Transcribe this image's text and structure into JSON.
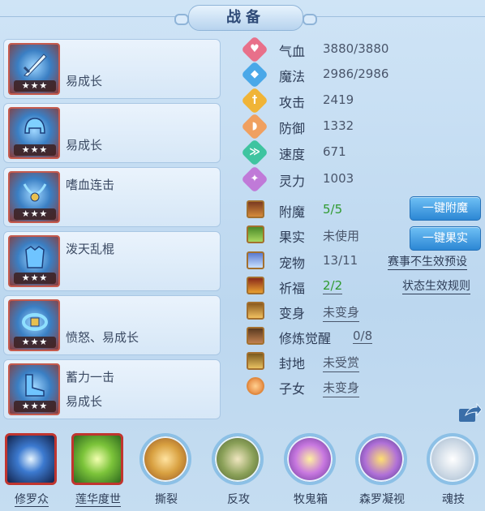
{
  "title": "战备",
  "equipment": [
    {
      "line1": "",
      "line2": "易成长",
      "stars": "★★★"
    },
    {
      "line1": "",
      "line2": "易成长",
      "stars": "★★★"
    },
    {
      "line1": "嗜血连击",
      "line2": "",
      "stars": "★★★"
    },
    {
      "line1": "泼天乱棍",
      "line2": "",
      "stars": "★★★"
    },
    {
      "line1": "",
      "line2": "愤怒、易成长",
      "stars": "★★★"
    },
    {
      "line1": "蓄力一击",
      "line2": "易成长",
      "stars": "★★★"
    }
  ],
  "stats": [
    {
      "name": "气血",
      "value": "3880/3880",
      "color": "#e8708a",
      "icon": "heart-icon",
      "glyph": "♥"
    },
    {
      "name": "魔法",
      "value": "2986/2986",
      "color": "#4aa8e8",
      "icon": "mana-icon",
      "glyph": "◆"
    },
    {
      "name": "攻击",
      "value": "2419",
      "color": "#f0b437",
      "icon": "sword-icon",
      "glyph": "†"
    },
    {
      "name": "防御",
      "value": "1332",
      "color": "#f0a060",
      "icon": "shield-icon",
      "glyph": "◗"
    },
    {
      "name": "速度",
      "value": "671",
      "color": "#3fc4a0",
      "icon": "speed-icon",
      "glyph": "≫"
    },
    {
      "name": "灵力",
      "value": "1003",
      "color": "#c07ad8",
      "icon": "spirit-icon",
      "glyph": "✦"
    }
  ],
  "features": [
    {
      "name": "附魔",
      "value": "5/5",
      "style": "green",
      "icon": "enchant-icon"
    },
    {
      "name": "果实",
      "value": "未使用",
      "style": "",
      "icon": "fruit-icon"
    },
    {
      "name": "宠物",
      "value": "13/11",
      "style": "",
      "icon": "pet-icon"
    },
    {
      "name": "祈福",
      "value": "2/2",
      "style": "green-ul",
      "icon": "blessing-icon"
    },
    {
      "name": "变身",
      "value": "未变身",
      "style": "ul",
      "icon": "transform-icon"
    },
    {
      "name": "修炼觉醒",
      "value": "0/8",
      "style": "far",
      "icon": "cultivation-icon"
    },
    {
      "name": "封地",
      "value": "未受赏",
      "style": "ul",
      "icon": "fief-icon"
    },
    {
      "name": "子女",
      "value": "未变身",
      "style": "ul",
      "icon": "children-icon"
    }
  ],
  "buttons": {
    "enchant": "一键附魔",
    "fruit": "一键果实"
  },
  "links": {
    "preset": "赛事不生效预设",
    "rules": "状态生效规则"
  },
  "skills": [
    {
      "label": "修罗众",
      "frame": "square",
      "underline": true,
      "bg": "radial-gradient(circle,#e8f6ff 0%,#3c7ad0 40%,#12224a 100%)"
    },
    {
      "label": "莲华度世",
      "frame": "square",
      "underline": true,
      "bg": "radial-gradient(circle,#f3ffb0 0%,#7cc43a 45%,#2f6a1e 100%)"
    },
    {
      "label": "撕裂",
      "frame": "ring",
      "underline": false,
      "bg": "radial-gradient(circle,#ffe3a0 0%,#d8a040 45%,#8a4a22 100%)"
    },
    {
      "label": "反攻",
      "frame": "ring",
      "underline": false,
      "bg": "radial-gradient(circle,#f0e6c0 0%,#8aa058 50%,#4a5a30 100%)"
    },
    {
      "label": "牧鬼箱",
      "frame": "ring",
      "underline": false,
      "bg": "radial-gradient(circle,#fff0a0 0%,#c878e0 45%,#5a2e8a 100%)"
    },
    {
      "label": "森罗凝视",
      "frame": "ring",
      "underline": false,
      "bg": "radial-gradient(circle,#ffe070 0%,#b070d8 50%,#40307a 100%)"
    },
    {
      "label": "魂技",
      "frame": "ring",
      "underline": false,
      "bg": "radial-gradient(circle,#ffffff 0%,#c9d6e3 55%,#9aaec2 100%)"
    }
  ]
}
